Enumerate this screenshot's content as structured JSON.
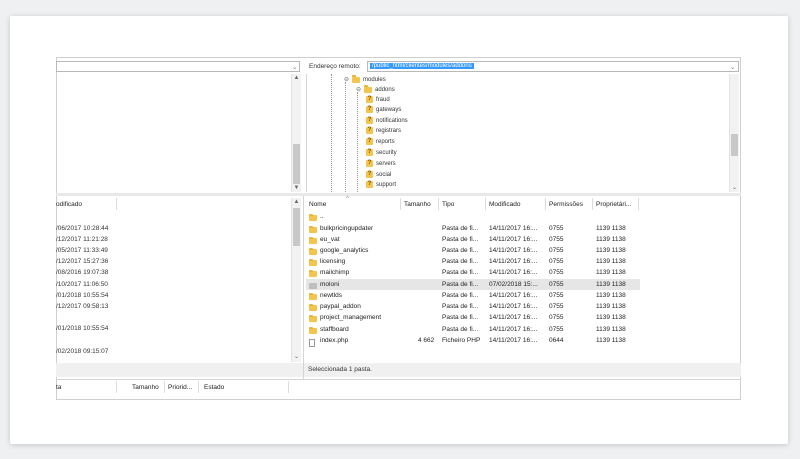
{
  "remote": {
    "address_label": "Endereço remoto:",
    "address_value": "/public_html/clientes/modules/addons"
  },
  "tree": [
    {
      "name": "modules",
      "level": 0,
      "icon": "folder"
    },
    {
      "name": "addons",
      "level": 1,
      "icon": "folder"
    },
    {
      "name": "fraud",
      "level": 2,
      "icon": "question-folder"
    },
    {
      "name": "gateways",
      "level": 2,
      "icon": "question-folder"
    },
    {
      "name": "notifications",
      "level": 2,
      "icon": "question-folder"
    },
    {
      "name": "registrars",
      "level": 2,
      "icon": "question-folder"
    },
    {
      "name": "reports",
      "level": 2,
      "icon": "question-folder"
    },
    {
      "name": "security",
      "level": 2,
      "icon": "question-folder"
    },
    {
      "name": "servers",
      "level": 2,
      "icon": "question-folder"
    },
    {
      "name": "social",
      "level": 2,
      "icon": "question-folder"
    },
    {
      "name": "support",
      "level": 2,
      "icon": "question-folder"
    }
  ],
  "local_list": {
    "header": "odificado",
    "dates": [
      "/06/2017 10:28:44",
      "/12/2017 11:21:28",
      "/05/2017 11:33:49",
      "/12/2017 15:27:36",
      "/08/2016 19:07:38",
      "/10/2017 11:06:50",
      "/01/2018 10:55:54",
      "/12/2017 09:58:13",
      "/01/2018 10:55:54",
      "/02/2018 09:15:07"
    ]
  },
  "remote_list": {
    "columns": {
      "name": "Nome",
      "size": "Tamanho",
      "type": "Tipo",
      "modified": "Modificado",
      "perms": "Permissões",
      "owner": "Proprietári..."
    },
    "rows": [
      {
        "name": "..",
        "size": "",
        "type": "",
        "modified": "",
        "perms": "",
        "owner": "",
        "icon": "folder"
      },
      {
        "name": "bulkpricingupdater",
        "size": "",
        "type": "Pasta de fi...",
        "modified": "14/11/2017 16:...",
        "perms": "0755",
        "owner": "1139 1138",
        "icon": "folder"
      },
      {
        "name": "eu_vat",
        "size": "",
        "type": "Pasta de fi...",
        "modified": "14/11/2017 16:...",
        "perms": "0755",
        "owner": "1139 1138",
        "icon": "folder"
      },
      {
        "name": "google_analytics",
        "size": "",
        "type": "Pasta de fi...",
        "modified": "14/11/2017 16:...",
        "perms": "0755",
        "owner": "1139 1138",
        "icon": "folder"
      },
      {
        "name": "licensing",
        "size": "",
        "type": "Pasta de fi...",
        "modified": "14/11/2017 16:...",
        "perms": "0755",
        "owner": "1139 1138",
        "icon": "folder"
      },
      {
        "name": "mailchimp",
        "size": "",
        "type": "Pasta de fi...",
        "modified": "14/11/2017 16:...",
        "perms": "0755",
        "owner": "1139 1138",
        "icon": "folder"
      },
      {
        "name": "moloni",
        "size": "",
        "type": "Pasta de fi...",
        "modified": "07/02/2018 15:...",
        "perms": "0755",
        "owner": "1139 1138",
        "icon": "gray-folder",
        "selected": true
      },
      {
        "name": "newtlds",
        "size": "",
        "type": "Pasta de fi...",
        "modified": "14/11/2017 16:...",
        "perms": "0755",
        "owner": "1139 1138",
        "icon": "folder"
      },
      {
        "name": "paypal_addon",
        "size": "",
        "type": "Pasta de fi...",
        "modified": "14/11/2017 16:...",
        "perms": "0755",
        "owner": "1139 1138",
        "icon": "folder"
      },
      {
        "name": "project_management",
        "size": "",
        "type": "Pasta de fi...",
        "modified": "14/11/2017 16:...",
        "perms": "0755",
        "owner": "1139 1138",
        "icon": "folder"
      },
      {
        "name": "staffboard",
        "size": "",
        "type": "Pasta de fi...",
        "modified": "14/11/2017 16:...",
        "perms": "0755",
        "owner": "1139 1138",
        "icon": "folder"
      },
      {
        "name": "index.php",
        "size": "4 662",
        "type": "Ficheiro PHP",
        "modified": "14/11/2017 16:...",
        "perms": "0644",
        "owner": "1139 1138",
        "icon": "file"
      }
    ],
    "status": "Seleccionada 1 pasta."
  },
  "queue": {
    "col1": "ta",
    "col2": "Tamanho",
    "col3": "Priorid...",
    "col4": "Estado"
  },
  "colors": {
    "selection": "#3399ff",
    "folder": "#f3c54f"
  }
}
